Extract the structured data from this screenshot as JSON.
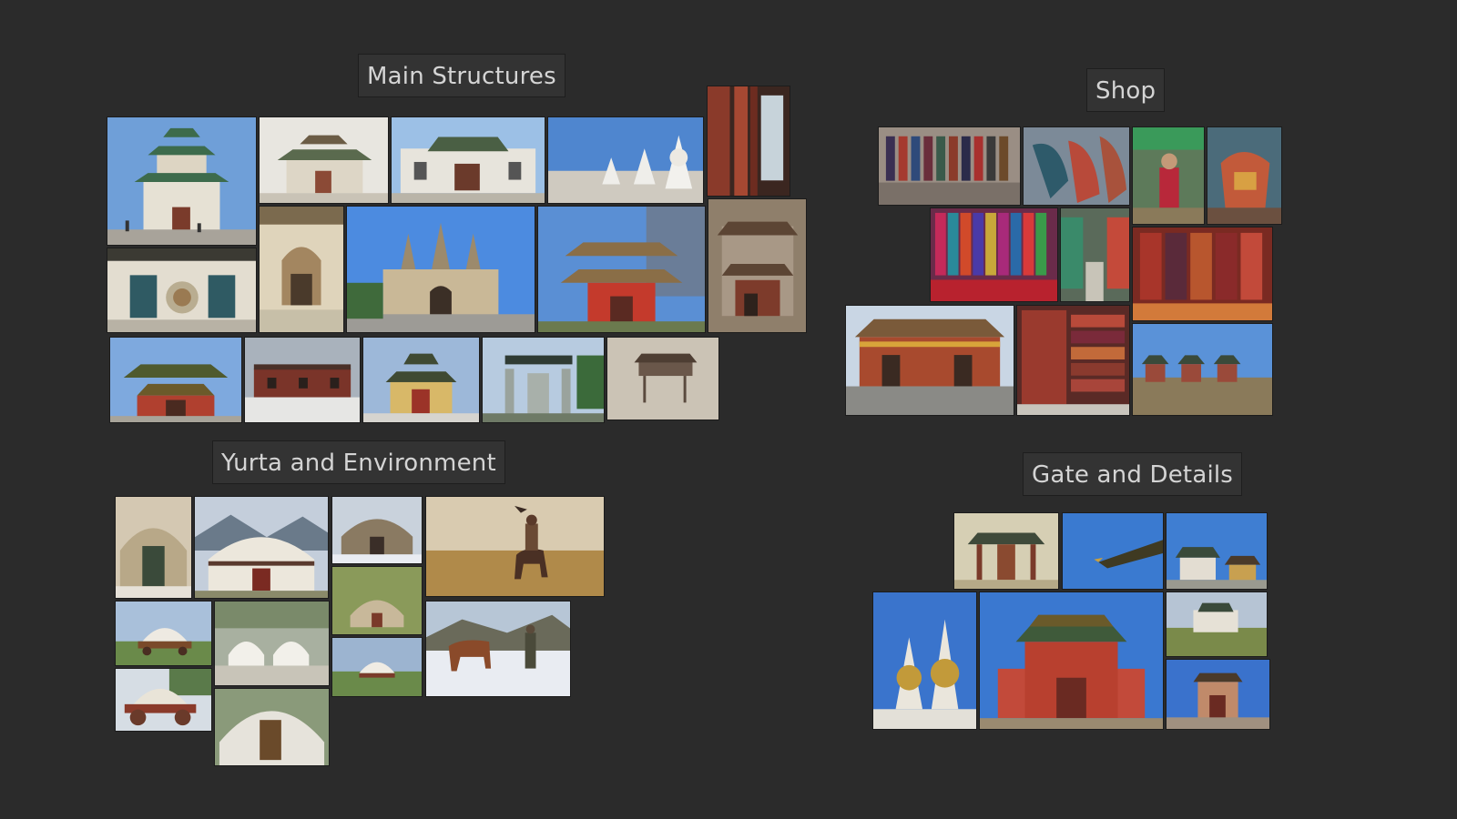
{
  "board": {
    "background": "#2b2b2b",
    "groups": [
      {
        "id": "main",
        "label": "Main Structures"
      },
      {
        "id": "shop",
        "label": "Shop"
      },
      {
        "id": "yurta",
        "label": "Yurta and Environment"
      },
      {
        "id": "gate",
        "label": "Gate and Details"
      }
    ]
  },
  "palette": {
    "sky": "#5f93d2",
    "pale_sky": "#cfd8e3",
    "wall_white": "#e4e0d6",
    "roof_green": "#3f6b4a",
    "roof_red": "#9b3b2c",
    "sand": "#c9ad79",
    "fabric_red": "#b5283a",
    "fabric_blue": "#3d4fa8",
    "grass": "#7c8a3c",
    "snow": "#e9ecf2"
  }
}
